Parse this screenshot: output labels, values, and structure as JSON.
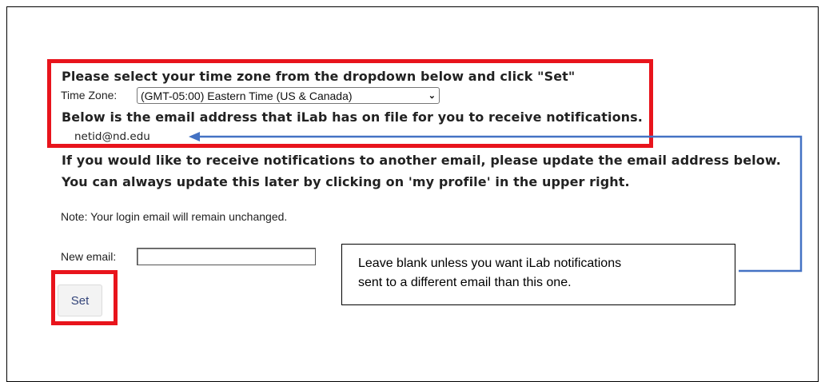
{
  "instruction_heading": "Please select your time zone from the dropdown below and click \"Set\"",
  "timezone": {
    "label": "Time Zone:",
    "selected": "(GMT-05:00) Eastern Time (US & Canada)"
  },
  "email_on_file_heading": "Below is the email address that iLab has on file for you to receive notifications.",
  "current_email": "netid@nd.edu",
  "update_line_1": "If you would like to receive notifications to another email, please update the email address below.",
  "update_line_2": "You can always update this later by clicking on 'my profile' in the upper right.",
  "note": "Note: Your login email will remain unchanged.",
  "new_email": {
    "label": "New email:",
    "value": ""
  },
  "set_button_label": "Set",
  "callout": {
    "line_1": "Leave blank unless you want iLab notifications",
    "line_2": "sent to a different email than this one."
  },
  "colors": {
    "highlight_red": "#e8141c",
    "connector_blue": "#4472c4",
    "button_text": "#34457a"
  }
}
